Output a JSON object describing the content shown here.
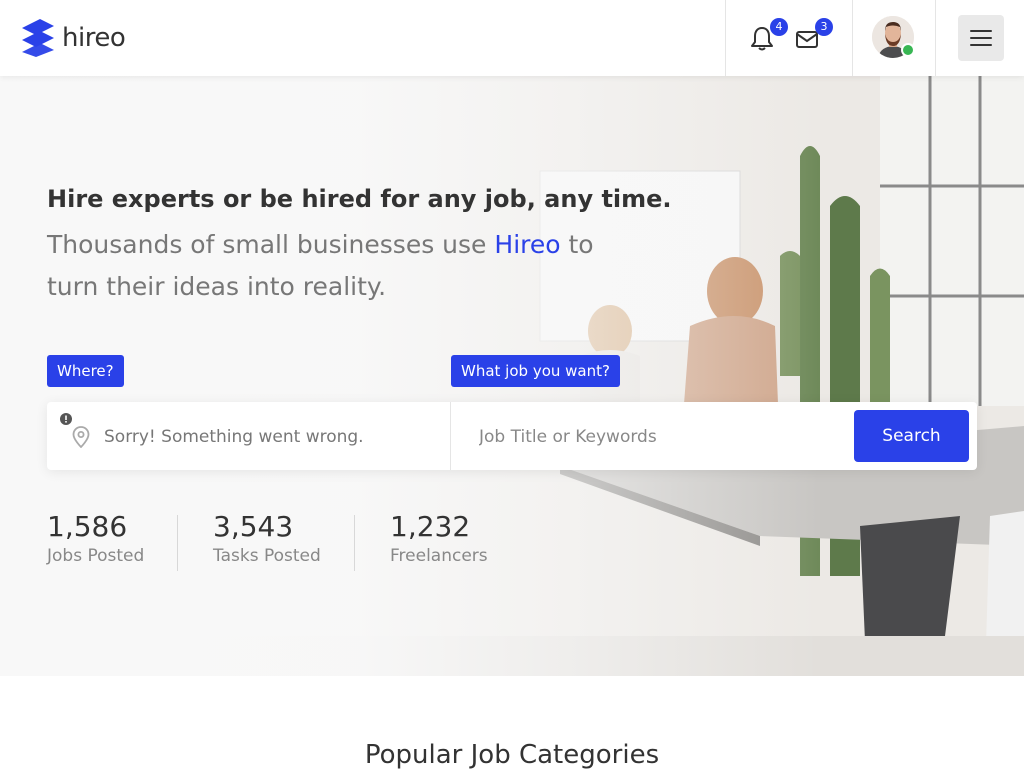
{
  "brand": {
    "logo_text": "hireo",
    "accent_color": "#2a41e8"
  },
  "header": {
    "notifications": {
      "icon": "bell-icon",
      "count": "4"
    },
    "messages": {
      "icon": "envelope-icon",
      "count": "3"
    },
    "user": {
      "status": "online",
      "status_color": "#38b653"
    },
    "menu_icon": "hamburger-icon"
  },
  "hero": {
    "title": "Hire experts or be hired for any job, any time.",
    "subtitle_before": "Thousands of small businesses use ",
    "subtitle_brand": "Hireo",
    "subtitle_after": " to turn their ideas into reality.",
    "where_label": "Where?",
    "what_label": "What job you want?",
    "where_value": "Sorry! Something went wrong.",
    "what_placeholder": "Job Title or Keywords",
    "search_button": "Search"
  },
  "stats": [
    {
      "value": "1,586",
      "label": "Jobs Posted"
    },
    {
      "value": "3,543",
      "label": "Tasks Posted"
    },
    {
      "value": "1,232",
      "label": "Freelancers"
    }
  ],
  "categories": {
    "title": "Popular Job Categories"
  }
}
